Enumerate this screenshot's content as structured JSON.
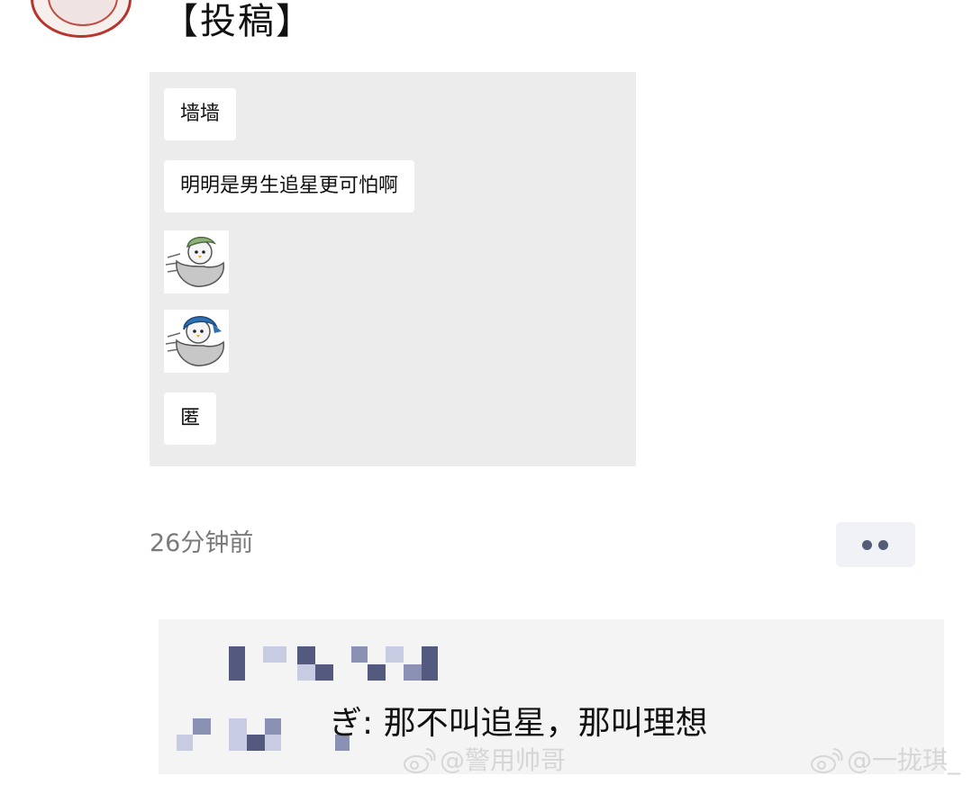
{
  "post": {
    "title": "【投稿】",
    "messages": [
      {
        "kind": "text",
        "text": "墙墙"
      },
      {
        "kind": "text",
        "text": "明明是男生追星更可怕啊"
      },
      {
        "kind": "sticker",
        "icon": "penguin-green-hat-sticker"
      },
      {
        "kind": "sticker",
        "icon": "penguin-blue-hat-sticker"
      },
      {
        "kind": "text",
        "text": "匿"
      }
    ],
    "timestamp": "26分钟前",
    "more_icon": "more-dots-icon"
  },
  "comment": {
    "author_visible": "ぎ",
    "text": ": 那不叫追星，那叫理想"
  },
  "watermarks": [
    {
      "text": "@警用帅哥",
      "icon": "weibo-icon"
    },
    {
      "text": "@一拢琪_",
      "icon": "weibo-icon"
    }
  ],
  "colors": {
    "image_background": "#ececec",
    "bubble_background": "#ffffff",
    "timestamp": "#7a7a7a",
    "more_dots": "#545c78",
    "comment_background": "#f4f4f4",
    "pixelation": "#8b91b5",
    "avatar_ring": "#b8342e"
  }
}
